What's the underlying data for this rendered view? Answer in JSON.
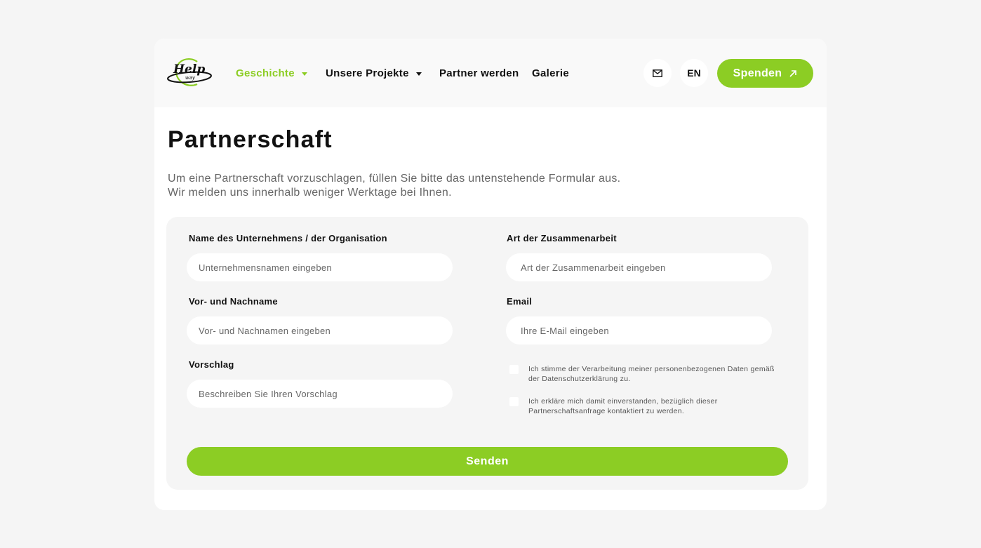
{
  "header": {
    "logo_text": "Help way",
    "nav": [
      {
        "label": "Geschichte",
        "has_dropdown": true,
        "active": true
      },
      {
        "label": "Unsere Projekte",
        "has_dropdown": true,
        "active": false
      },
      {
        "label": "Partner werden",
        "has_dropdown": false,
        "active": false
      },
      {
        "label": "Galerie",
        "has_dropdown": false,
        "active": false
      }
    ],
    "mail_icon": "mail-icon",
    "language": "EN",
    "donate_label": "Spenden",
    "donate_icon": "arrow-up-right-icon"
  },
  "page": {
    "title": "Partnerschaft",
    "intro_lines": [
      "Um eine Partnerschaft vorzuschlagen, füllen Sie bitte das untenstehende Formular aus.",
      "Wir melden uns innerhalb weniger Werktage bei Ihnen."
    ]
  },
  "form": {
    "company": {
      "label": "Name des Unternehmens / der Organisation",
      "placeholder": "Unternehmensnamen eingeben",
      "value": ""
    },
    "cooperation": {
      "label": "Art der Zusammenarbeit",
      "placeholder": "Art der Zusammenarbeit eingeben",
      "value": ""
    },
    "name": {
      "label": "Vor- und Nachname",
      "placeholder": "Vor- und Nachnamen eingeben",
      "value": ""
    },
    "email": {
      "label": "Email",
      "placeholder": "Ihre E-Mail eingeben",
      "value": ""
    },
    "proposal": {
      "label": "Vorschlag",
      "placeholder": "Beschreiben Sie Ihren Vorschlag",
      "value": ""
    },
    "consent_privacy": {
      "lines": [
        "Ich stimme der Verarbeitung meiner personenbezogenen Daten gemäß",
        "der Datenschutzerklärung zu."
      ],
      "checked": false
    },
    "consent_contact": {
      "lines": [
        "Ich erkläre mich damit einverstanden, bezüglich dieser",
        "Partnerschaftsanfrage kontaktiert zu werden."
      ],
      "checked": false
    },
    "submit_label": "Senden"
  },
  "colors": {
    "accent": "#8ccd24",
    "background": "#f5f5f5",
    "card": "#ffffff",
    "text": "#111111",
    "muted": "#666666"
  }
}
